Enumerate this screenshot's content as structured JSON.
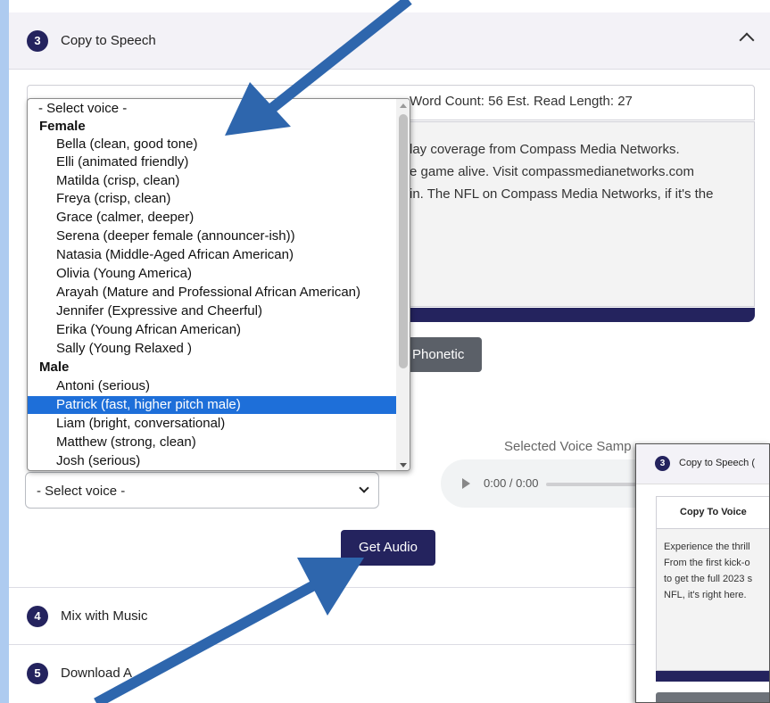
{
  "section3": {
    "number": "3",
    "title": "Copy to Speech"
  },
  "word_count_text": "Word Count: 56 Est. Read Length: 27",
  "script_lines": [
    "lay coverage from Compass Media Networks.",
    "e game alive. Visit compassmedianetworks.com",
    "in. The NFL on Compass Media Networks, if it's the"
  ],
  "phonetic_button": "Phonetic",
  "selected_voice_sample_label": "Selected Voice Samp",
  "audio": {
    "time": "0:00 / 0:00"
  },
  "voice_select": {
    "value": "- Select voice -"
  },
  "get_audio_button": "Get Audio",
  "section4": {
    "number": "4",
    "title": "Mix with Music"
  },
  "section5": {
    "number": "5",
    "title": "Download A"
  },
  "dropdown": {
    "placeholder": "- Select voice -",
    "female_label": "Female",
    "female": [
      "Bella (clean, good tone)",
      "Elli (animated friendly)",
      "Matilda (crisp, clean)",
      "Freya (crisp, clean)",
      "Grace (calmer, deeper)",
      "Serena (deeper female (announcer-ish))",
      "Natasia (Middle-Aged African American)",
      "Olivia (Young America)",
      "Arayah (Mature and Professional African American)",
      "Jennifer (Expressive and Cheerful)",
      "Erika (Young African American)",
      "Sally (Young Relaxed )"
    ],
    "male_label": "Male",
    "male": [
      "Antoni (serious)",
      "Patrick (fast, higher pitch male)",
      "Liam (bright, conversational)",
      "Matthew (strong, clean)",
      "Josh (serious)"
    ],
    "highlighted": "Patrick (fast, higher pitch male)"
  },
  "inset": {
    "number": "3",
    "title": "Copy to Speech (",
    "tab": "Copy To Voice",
    "lines": [
      "Experience the thrill",
      "From the first kick-o",
      "to get the full 2023 s",
      "NFL, it's right here."
    ]
  },
  "colors": {
    "navy": "#24235e",
    "arrow": "#2e66ad",
    "page_bg": "#aecbf0",
    "highlight": "#1e6fd9"
  }
}
